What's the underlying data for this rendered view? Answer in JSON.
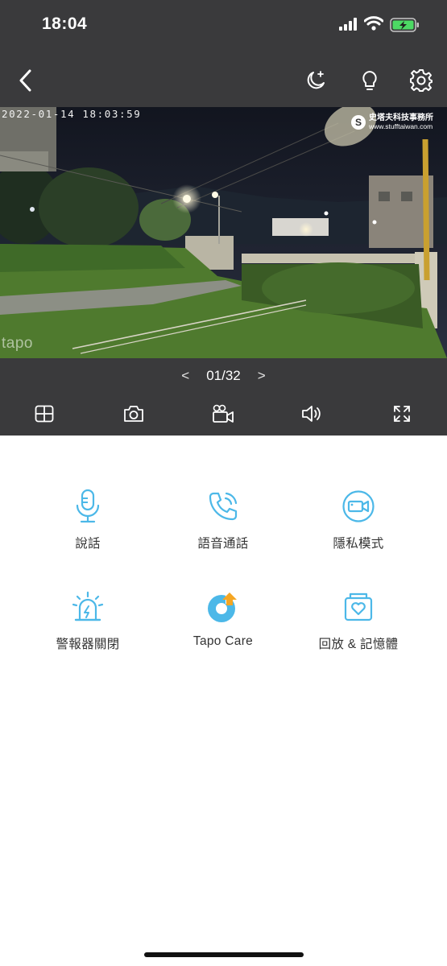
{
  "status_bar": {
    "time": "18:04"
  },
  "video": {
    "timestamp": "2022-01-14  18:03:59",
    "watermark_cn": "史塔夫科技事務所",
    "watermark_url": "www.stufftaiwan.com",
    "camera_logo": "tapo"
  },
  "pager": {
    "prev": "<",
    "current": "01/32",
    "next": ">"
  },
  "features": [
    {
      "label": "說話",
      "icon": "microphone-icon"
    },
    {
      "label": "語音通話",
      "icon": "phone-call-icon"
    },
    {
      "label": "隱私模式",
      "icon": "privacy-camera-icon"
    },
    {
      "label": "警報器關閉",
      "icon": "alarm-siren-icon"
    },
    {
      "label": "Tapo Care",
      "icon": "tapo-care-icon"
    },
    {
      "label": "回放 & 記憶體",
      "icon": "playback-memory-icon"
    }
  ],
  "icons": {
    "nav": [
      "back-chevron-icon",
      "night-mode-icon",
      "light-bulb-icon",
      "settings-gear-icon"
    ],
    "toolbar": [
      "multi-view-icon",
      "snapshot-camera-icon",
      "record-video-icon",
      "speaker-icon",
      "fullscreen-icon"
    ]
  },
  "colors": {
    "accent": "#4cb8e8",
    "tapo_care_orange": "#f5a623",
    "header_bg": "#3a3a3c",
    "battery_green": "#4cd964"
  }
}
